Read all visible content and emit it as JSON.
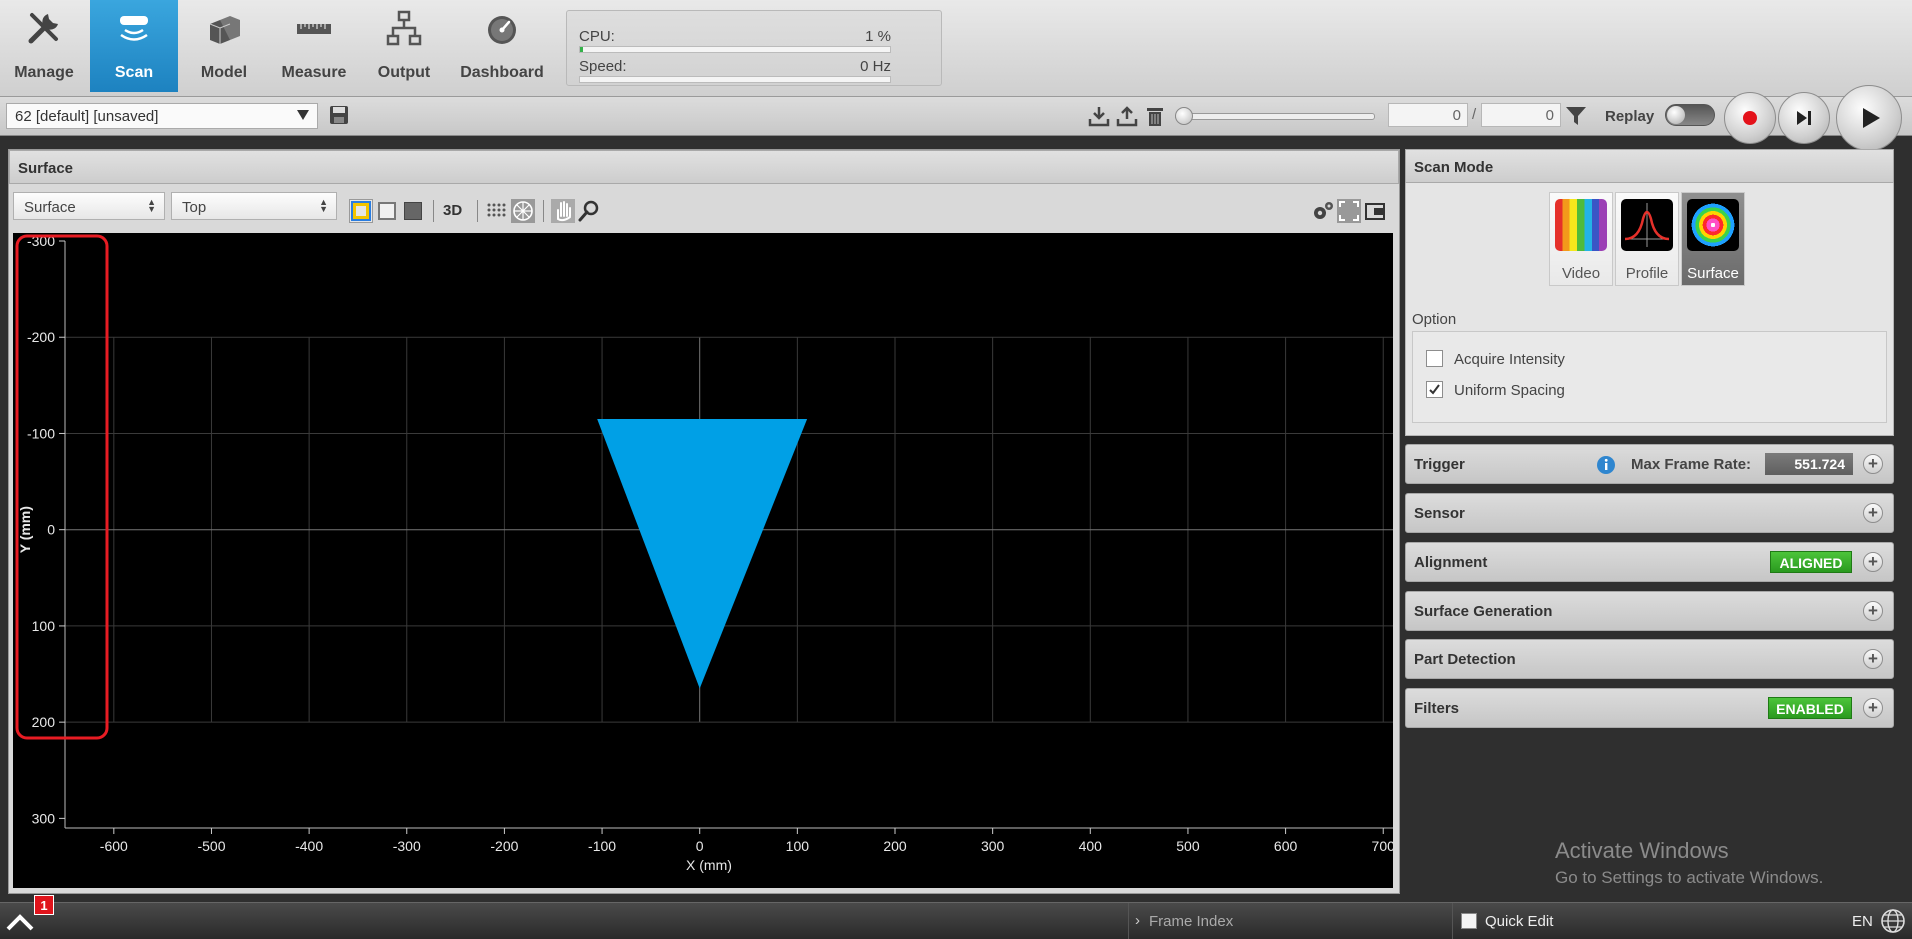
{
  "nav": {
    "tabs": [
      {
        "label": "Manage",
        "icon": "tools-icon"
      },
      {
        "label": "Scan",
        "icon": "scan-sensor-icon",
        "active": true
      },
      {
        "label": "Model",
        "icon": "cubes-icon"
      },
      {
        "label": "Measure",
        "icon": "ruler-icon"
      },
      {
        "label": "Output",
        "icon": "network-icon"
      },
      {
        "label": "Dashboard",
        "icon": "gauge-icon"
      }
    ]
  },
  "stats": {
    "cpu_label": "CPU:",
    "cpu_value": "1 %",
    "cpu_fraction": 0.01,
    "speed_label": "Speed:",
    "speed_value": "0 Hz",
    "speed_fraction": 0.0
  },
  "toolbar": {
    "job_value": "62 [default] [unsaved]",
    "frame_current": "0",
    "separator": "/",
    "frame_total": "0",
    "replay_label": "Replay",
    "slider_position": 0.0
  },
  "surface_panel": {
    "title": "Surface",
    "view_select": "Surface",
    "orientation_select": "Top",
    "btn_3d": "3D"
  },
  "chart_data": {
    "type": "scatter",
    "xlabel": "X (mm)",
    "ylabel": "Y (mm)",
    "xlim": [
      -650,
      710
    ],
    "ylim": [
      -300,
      310
    ],
    "y_inverted": true,
    "xticks": [
      -600,
      -500,
      -400,
      -300,
      -200,
      -100,
      0,
      100,
      200,
      300,
      400,
      500,
      600,
      700
    ],
    "yticks": [
      -300,
      -200,
      -100,
      0,
      100,
      200,
      300
    ],
    "grid": true,
    "series": [
      {
        "shape": "triangle",
        "color": "#00a0e6",
        "points": [
          [
            -105,
            -115
          ],
          [
            110,
            -115
          ],
          [
            0,
            165
          ]
        ]
      }
    ],
    "highlight_box": {
      "label": "Y axis",
      "color": "#e81c23"
    }
  },
  "scan_mode": {
    "title": "Scan Mode",
    "modes": [
      {
        "label": "Video",
        "icon": "video-bars-icon"
      },
      {
        "label": "Profile",
        "icon": "profile-curve-icon"
      },
      {
        "label": "Surface",
        "icon": "surface-rings-icon",
        "active": true
      }
    ],
    "option_label": "Option",
    "options": [
      {
        "label": "Acquire Intensity",
        "checked": false
      },
      {
        "label": "Uniform Spacing",
        "checked": true
      }
    ]
  },
  "sections": [
    {
      "label": "Trigger",
      "extra_label": "Max Frame Rate:",
      "extra_value": "551.724"
    },
    {
      "label": "Sensor"
    },
    {
      "label": "Alignment",
      "badge": "ALIGNED"
    },
    {
      "label": "Surface Generation"
    },
    {
      "label": "Part Detection"
    },
    {
      "label": "Filters",
      "badge": "ENABLED"
    }
  ],
  "statusbar": {
    "notification_count": "1",
    "frame_index_label": "Frame Index",
    "quick_edit_label": "Quick Edit",
    "language": "EN"
  },
  "watermark": {
    "line1": "Activate Windows",
    "line2": "Go to Settings to activate Windows."
  },
  "colors": {
    "accent": "#1d82c0",
    "badge_green": "#2fa524",
    "surface_blue": "#00a0e6"
  }
}
